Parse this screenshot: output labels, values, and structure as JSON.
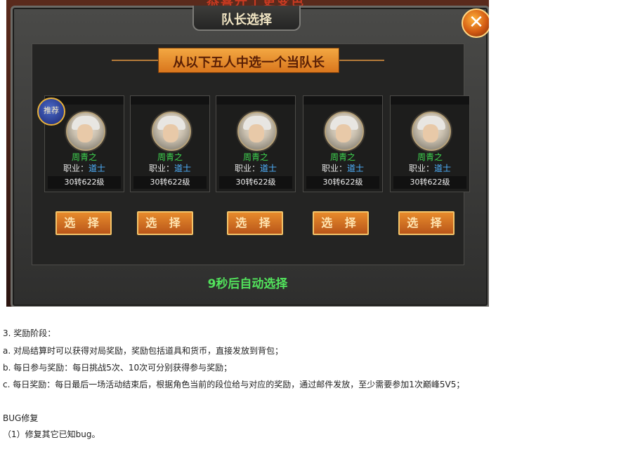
{
  "dialog": {
    "top_banner": "恭喜开了更变色",
    "title": "队长选择",
    "close_icon": "close-icon",
    "prompt": "从以下五人中选一个当队长",
    "recommended_badge": "推荐",
    "auto_select": "9秒后自动选择",
    "select_label": "选 择",
    "candidates": [
      {
        "name": "周青之",
        "job_label": "职业：",
        "job": "道士",
        "level": "30转622级"
      },
      {
        "name": "周青之",
        "job_label": "职业：",
        "job": "道士",
        "level": "30转622级"
      },
      {
        "name": "周青之",
        "job_label": "职业：",
        "job": "道士",
        "level": "30转622级"
      },
      {
        "name": "周青之",
        "job_label": "职业：",
        "job": "道士",
        "level": "30转622级"
      },
      {
        "name": "周青之",
        "job_label": "职业：",
        "job": "道士",
        "level": "30转622级"
      }
    ]
  },
  "doc": {
    "lines": [
      "3.   奖励阶段：",
      "a.   对局结算时可以获得对局奖励，奖励包括道具和货币，直接发放到背包；",
      "b.   每日参与奖励：每日挑战5次、10次可分别获得参与奖励；",
      "c.   每日奖励：每日最后一场活动结束后，根据角色当前的段位给与对应的奖励，通过邮件发放，至少需要参加1次巅峰5V5；",
      "BUG修复",
      "（1）修复其它已知bug。"
    ]
  }
}
